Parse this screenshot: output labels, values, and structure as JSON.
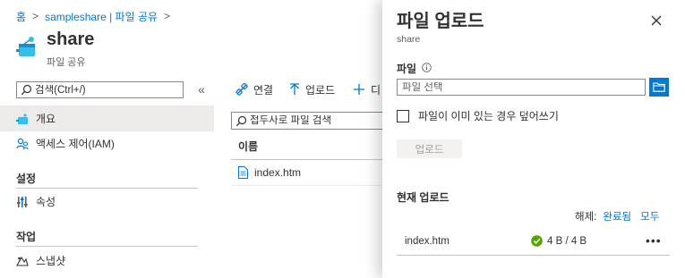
{
  "breadcrumb": {
    "home": "홈",
    "resource": "sampleshare | 파일 공유"
  },
  "header": {
    "title": "share",
    "subtitle": "파일 공유"
  },
  "sidebar": {
    "search_placeholder": "검색(Ctrl+/)",
    "collapse_glyph": "«",
    "items": [
      {
        "label": "개요",
        "icon": "file-share-icon",
        "selected": true
      },
      {
        "label": "액세스 제어(IAM)",
        "icon": "people-icon",
        "selected": false
      }
    ],
    "sections": [
      {
        "title": "설정",
        "items": [
          {
            "label": "속성",
            "icon": "properties-icon"
          }
        ]
      },
      {
        "title": "작업",
        "items": [
          {
            "label": "스냅샷",
            "icon": "snapshot-icon"
          }
        ]
      }
    ]
  },
  "toolbar": {
    "connect_label": "연결",
    "upload_label": "업로드",
    "add_label_partial": "디"
  },
  "content": {
    "search_placeholder": "접두사로 파일 검색",
    "column_name": "이름",
    "files": [
      {
        "name": "index.htm",
        "icon": "document-icon"
      }
    ]
  },
  "panel": {
    "title": "파일 업로드",
    "subtitle": "share",
    "file_label": "파일",
    "file_placeholder": "파일 선택",
    "overwrite_label": "파일이 이미 있는 경우 덮어쓰기",
    "overwrite_checked": false,
    "upload_button": "업로드",
    "current_uploads_title": "현재 업로드",
    "clear_label": "해제:",
    "clear_completed": "완료됨",
    "clear_all": "모두",
    "uploads": [
      {
        "filename": "index.htm",
        "progress": "4 B / 4 B",
        "status": "success"
      }
    ]
  },
  "colors": {
    "accent": "#0078d4",
    "success": "#57a300",
    "selected_bg": "#edebe9"
  }
}
